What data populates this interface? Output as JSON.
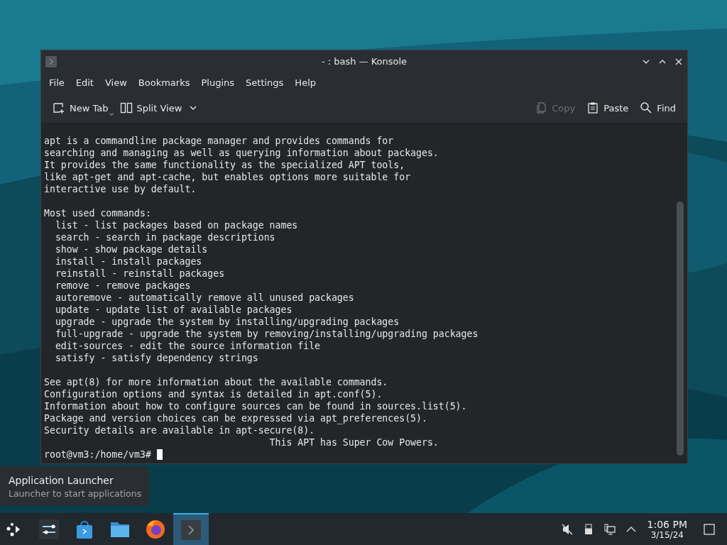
{
  "window": {
    "title": "- : bash — Konsole",
    "menu": [
      "File",
      "Edit",
      "View",
      "Bookmarks",
      "Plugins",
      "Settings",
      "Help"
    ],
    "toolbar_left": [
      {
        "label": "New Tab",
        "disabled": false
      },
      {
        "label": "Split View",
        "disabled": false
      }
    ],
    "toolbar_right": [
      {
        "label": "Copy",
        "disabled": true
      },
      {
        "label": "Paste",
        "disabled": false
      },
      {
        "label": "Find",
        "disabled": false
      }
    ],
    "terminal": {
      "blocks": [
        [
          "apt is a commandline package manager and provides commands for",
          "searching and managing as well as querying information about packages.",
          "It provides the same functionality as the specialized APT tools,",
          "like apt-get and apt-cache, but enables options more suitable for",
          "interactive use by default."
        ],
        [
          "Most used commands:",
          "  list - list packages based on package names",
          "  search - search in package descriptions",
          "  show - show package details",
          "  install - install packages",
          "  reinstall - reinstall packages",
          "  remove - remove packages",
          "  autoremove - automatically remove all unused packages",
          "  update - update list of available packages",
          "  upgrade - upgrade the system by installing/upgrading packages",
          "  full-upgrade - upgrade the system by removing/installing/upgrading packages",
          "  edit-sources - edit the source information file",
          "  satisfy - satisfy dependency strings"
        ],
        [
          "See apt(8) for more information about the available commands.",
          "Configuration options and syntax is detailed in apt.conf(5).",
          "Information about how to configure sources can be found in sources.list(5).",
          "Package and version choices can be expressed via apt_preferences(5).",
          "Security details are available in apt-secure(8).",
          "                                        This APT has Super Cow Powers."
        ]
      ],
      "prompt": "root@vm3:/home/vm3# "
    }
  },
  "tooltip": {
    "title": "Application Launcher",
    "subtitle": "Launcher to start applications"
  },
  "taskbar": {
    "apps": [
      {
        "selected": false
      },
      {
        "selected": false
      },
      {
        "selected": false
      },
      {
        "selected": false
      },
      {
        "selected": true
      }
    ],
    "clock": {
      "time": "1:06 PM",
      "date": "3/15/24"
    }
  }
}
